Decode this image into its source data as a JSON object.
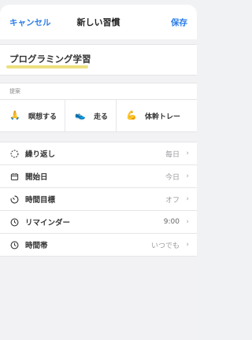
{
  "header": {
    "cancel_label": "キャンセル",
    "title": "新しい習慣",
    "save_label": "保存"
  },
  "habit_name": {
    "value": "プログラミング学習"
  },
  "suggestions": {
    "label": "提案",
    "items": [
      {
        "label": "瞑想する",
        "icon": "praying-hands-icon"
      },
      {
        "label": "走る",
        "icon": "running-shoe-icon"
      },
      {
        "label": "体幹トレー",
        "icon": "flexed-biceps-icon"
      }
    ]
  },
  "settings": [
    {
      "label": "繰り返し",
      "value": "毎日",
      "icon": "dashed-circle-icon"
    },
    {
      "label": "開始日",
      "value": "今日",
      "icon": "calendar-icon"
    },
    {
      "label": "時間目標",
      "value": "オフ",
      "icon": "timer-icon"
    },
    {
      "label": "リマインダー",
      "value": "9:00",
      "icon": "clock-icon"
    },
    {
      "label": "時間帯",
      "value": "いつでも",
      "icon": "clock-icon"
    }
  ],
  "colors": {
    "accent": "#2b7de9",
    "highlight": "#eadb6a",
    "background": "#f2f2f4"
  }
}
